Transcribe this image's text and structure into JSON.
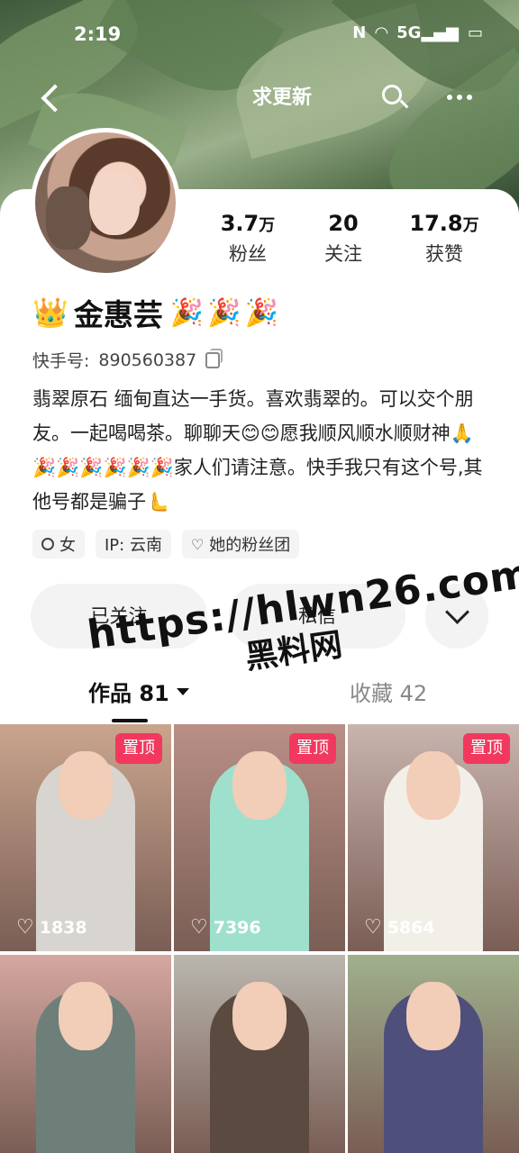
{
  "status_bar": {
    "time": "2:19",
    "icons": [
      "nfc-icon",
      "wifi-icon",
      "5g-signal-icon",
      "battery-icon"
    ]
  },
  "topbar": {
    "update_label": "求更新"
  },
  "profile": {
    "name": "金惠芸",
    "kuaishou_id_label": "快手号:",
    "kuaishou_id": "890560387",
    "bio": "翡翠原石 缅甸直达一手货。喜欢翡翠的。可以交个朋友。一起喝喝茶。聊聊天😊😊愿我顺风顺水顺财神🙏🎉🎉🎉🎉🎉🎉家人们请注意。快手我只有这个号,其他号都是骗子🫷"
  },
  "stats": [
    {
      "num": "3.7",
      "unit": "万",
      "label": "粉丝"
    },
    {
      "num": "20",
      "unit": "",
      "label": "关注"
    },
    {
      "num": "17.8",
      "unit": "万",
      "label": "获赞"
    }
  ],
  "tags": {
    "gender": "女",
    "ip": "IP:  云南",
    "fan_group": "她的粉丝团"
  },
  "actions": {
    "followed": "已关注",
    "private": "私信"
  },
  "watermark": {
    "url": "https://hlwn26.com",
    "cn": "黑料网"
  },
  "tabs": {
    "works": "作品 81",
    "favorites": "收藏 42"
  },
  "grid": [
    {
      "pinned": "置顶",
      "likes": "1838",
      "bg": "#c9a58e",
      "body": "#d8d4cf"
    },
    {
      "pinned": "置顶",
      "likes": "7396",
      "bg": "#b98f86",
      "body": "#9fe0cc"
    },
    {
      "pinned": "置顶",
      "likes": "5864",
      "bg": "#c8b4ae",
      "body": "#f2efe8"
    },
    {
      "pinned": "",
      "likes": "",
      "bg": "#d5a7a0",
      "body": "#6e7f7a"
    },
    {
      "pinned": "",
      "likes": "",
      "bg": "#b9b6ae",
      "body": "#5b4a40"
    },
    {
      "pinned": "",
      "likes": "",
      "bg": "#9fb08d",
      "body": "#4e4f7a"
    }
  ],
  "colors": {
    "pin": "#f2385e",
    "accent": "#111111"
  }
}
